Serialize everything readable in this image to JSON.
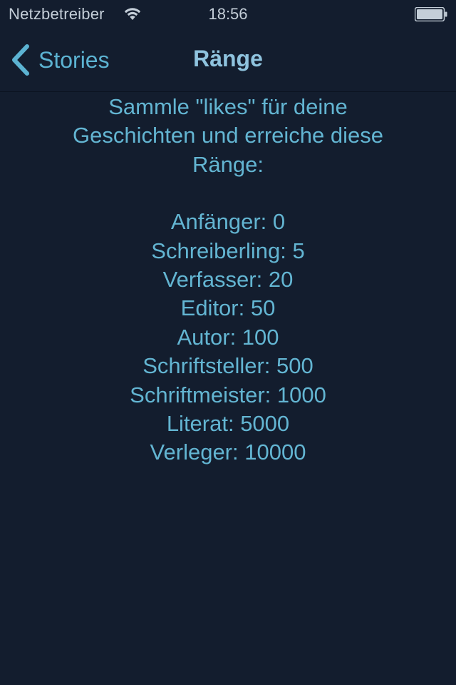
{
  "statusbar": {
    "carrier": "Netzbetreiber",
    "time": "18:56",
    "wifi_icon": "wifi-icon",
    "battery_icon": "battery-icon"
  },
  "navbar": {
    "back_label": "Stories",
    "back_icon": "chevron-left-icon",
    "title": "Ränge"
  },
  "content": {
    "intro": "Sammle \"likes\" für deine Geschichten und erreiche diese Ränge:",
    "ranks": [
      "Anfänger: 0",
      "Schreiberling: 5",
      "Verfasser: 20",
      "Editor: 50",
      "Autor: 100",
      "Schriftsteller: 500",
      "Schriftmeister: 1000",
      "Literat: 5000",
      "Verleger: 10000"
    ]
  },
  "colors": {
    "background": "#131d2e",
    "accent": "#5cb3d2",
    "title": "#8fc3de",
    "text": "#63b5d2",
    "statusbar_text": "#c4ced8"
  }
}
